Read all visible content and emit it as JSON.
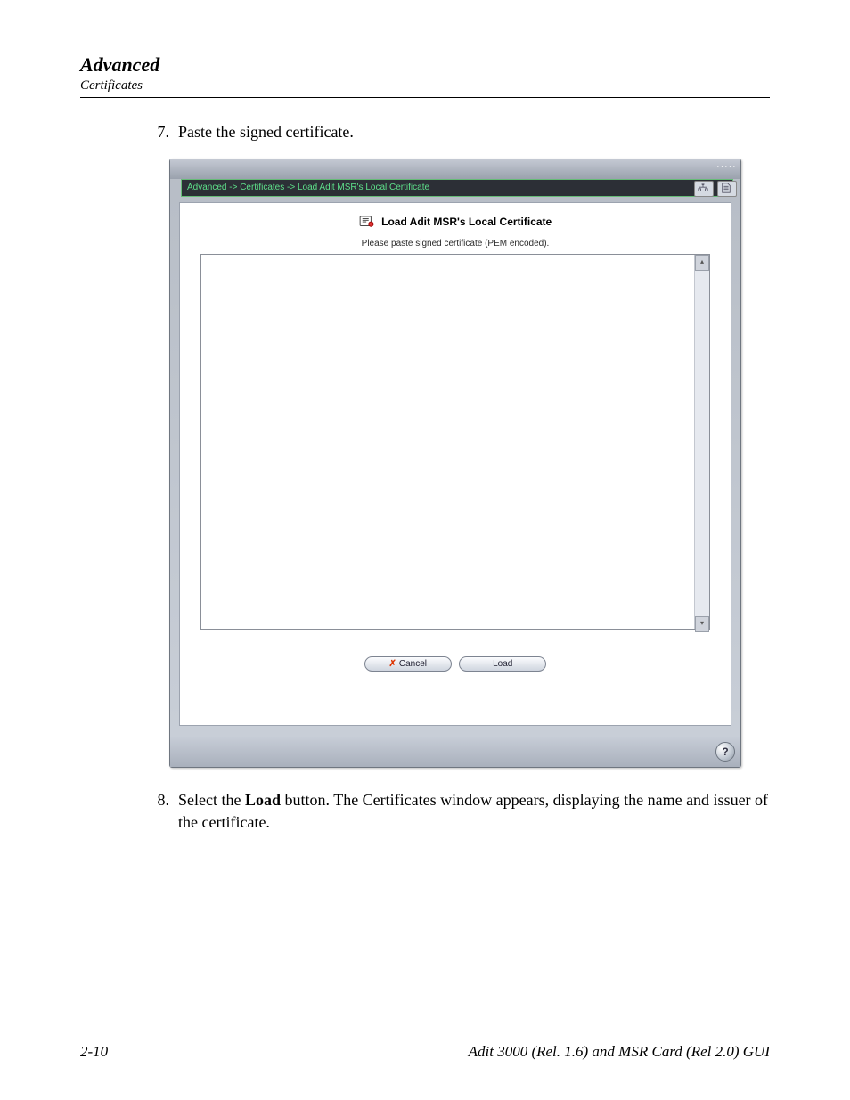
{
  "header": {
    "title": "Advanced",
    "subtitle": "Certificates"
  },
  "steps": [
    {
      "num": "7.",
      "text": "Paste the signed certificate."
    },
    {
      "num": "8.",
      "pre": "Select the ",
      "bold": "Load",
      "post": " button.  The Certificates window appears, displaying the name and issuer of the certificate."
    }
  ],
  "panel": {
    "breadcrumb": "Advanced -> Certificates -> Load Adit MSR's Local Certificate",
    "title": "Load Adit MSR's Local Certificate",
    "instruction": "Please paste signed certificate (PEM encoded).",
    "textarea_placeholder": "",
    "buttons": {
      "cancel": "Cancel",
      "load": "Load"
    }
  },
  "footer": {
    "page": "2-10",
    "doc": "Adit 3000 (Rel. 1.6) and MSR Card (Rel 2.0) GUI"
  }
}
